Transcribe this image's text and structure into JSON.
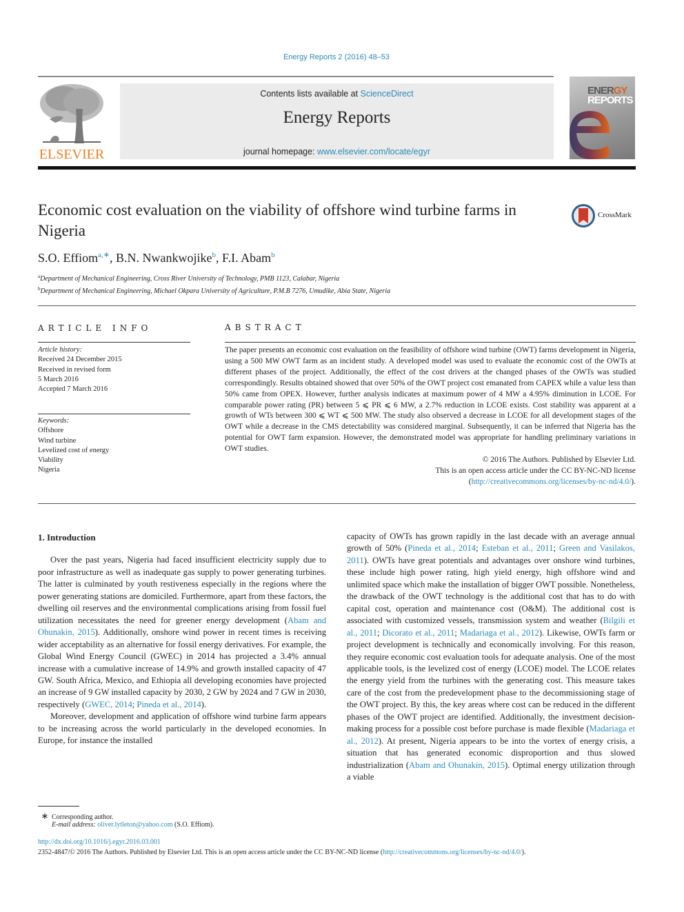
{
  "header": {
    "journal_ref": "Energy Reports 2 (2016) 48–53",
    "contents_prefix": "Contents lists available at ",
    "contents_link": "ScienceDirect",
    "journal_title": "Energy Reports",
    "homepage_prefix": "journal homepage: ",
    "homepage_link": "www.elsevier.com/locate/egyr",
    "publisher_logo_text": "ELSEVIER",
    "cover_line1_a": "ENER",
    "cover_line1_b": "GY",
    "cover_line2": "REPORTS",
    "crossmark_label": "CrossMark"
  },
  "article": {
    "title": "Economic cost evaluation on the viability of offshore wind turbine farms in Nigeria",
    "authors": [
      {
        "name": "S.O. Effiom",
        "sup": "a,∗"
      },
      {
        "name": "B.N. Nwankwojike",
        "sup": "b"
      },
      {
        "name": "F.I. Abam",
        "sup": "b"
      }
    ],
    "affiliations": [
      {
        "mark": "a",
        "text": "Department of Mechanical Engineering, Cross River University of Technology, PMB 1123, Calabar, Nigeria"
      },
      {
        "mark": "b",
        "text": "Department of Mechanical Engineering, Michael Okpara University of Agriculture, P.M.B 7276, Umudike, Abia State, Nigeria"
      }
    ]
  },
  "article_info": {
    "heading": "ARTICLE INFO",
    "history_label": "Article history:",
    "history": [
      "Received 24 December 2015",
      "Received in revised form",
      "5 March 2016",
      "Accepted 7 March 2016"
    ],
    "keywords_label": "Keywords:",
    "keywords": [
      "Offshore",
      "Wind turbine",
      "Levelized cost of energy",
      "Viability",
      "Nigeria"
    ]
  },
  "abstract": {
    "heading": "ABSTRACT",
    "text": "The paper presents an economic cost evaluation on the feasibility of offshore wind turbine (OWT) farms development in Nigeria, using a 500 MW OWT farm as an incident study. A developed model was used to evaluate the economic cost of the OWTs at different phases of the project. Additionally, the effect of the cost drivers at the changed phases of the OWTs was studied correspondingly. Results obtained showed that over 50% of the OWT project cost emanated from CAPEX while a value less than 50% came from OPEX. However, further analysis indicates at maximum power of 4 MW a 4.95% diminution in LCOE. For comparable power rating (PR) between 5 ⩽ PR ⩽ 6 MW, a 2.7% reduction in LCOE exists. Cost stability was apparent at a growth of WTs between 300 ⩽ WT ⩽ 500 MW. The study also observed a decrease in LCOE for all development stages of the OWT while a decrease in the CMS detectability was considered marginal. Subsequently, it can be inferred that Nigeria has the potential for OWT farm expansion. However, the demonstrated model was appropriate for handling preliminary variations in OWT studies.",
    "copyright": "© 2016 The Authors. Published by Elsevier Ltd.",
    "license_line": "This is an open access article under the CC BY-NC-ND license",
    "license_link": "http://creativecommons.org/licenses/by-nc-nd/4.0/"
  },
  "body": {
    "section_title": "1.  Introduction",
    "left_p1": [
      {
        "t": "Over the past years, Nigeria had faced insufficient electricity supply due to poor infrastructure as well as inadequate gas supply to power generating turbines. The latter is culminated by youth restiveness especially in the regions where the power generating stations are domiciled. Furthermore, apart from these factors, the dwelling oil reserves and the environmental complications arising from fossil fuel utilization necessitates the need for greener energy development ("
      },
      {
        "link": "Abam and Ohunakin, 2015"
      },
      {
        "t": "). Additionally, onshore wind power in recent times is receiving wider acceptability as an alternative for fossil energy derivatives. For example, the Global Wind Energy Council (GWEC) in 2014 has projected a 3.4% annual increase with a cumulative increase of 14.9% and growth installed capacity of 47 GW. South Africa, Mexico, and Ethiopia all developing economies have projected an increase of 9 GW installed capacity by 2030, 2 GW by 2024 and 7 GW in 2030, respectively ("
      },
      {
        "link": "GWEC, 2014"
      },
      {
        "t": "; "
      },
      {
        "link": "Pineda et al., 2014"
      },
      {
        "t": ")."
      }
    ],
    "left_p2": [
      {
        "t": "Moreover, development and application of offshore wind turbine farm appears to be increasing across the world particularly in the developed economies. In Europe, for instance the installed"
      }
    ],
    "right_p1": [
      {
        "t": "capacity of OWTs has grown rapidly in the last decade with an average annual growth of 50% ("
      },
      {
        "link": "Pineda et al., 2014"
      },
      {
        "t": "; "
      },
      {
        "link": "Esteban et al., 2011"
      },
      {
        "t": "; "
      },
      {
        "link": "Green and Vasilakos, 2011"
      },
      {
        "t": "). OWTs have great potentials and advantages over onshore wind turbines, these include high power rating, high yield energy, high offshore wind and unlimited space which make the installation of bigger OWT possible. Nonetheless, the drawback of the OWT technology is the additional cost that has to do with capital cost, operation and maintenance cost (O&M). The additional cost is associated with customized vessels, transmission system and weather ("
      },
      {
        "link": "Bilgili et al., 2011"
      },
      {
        "t": "; "
      },
      {
        "link": "Dicorato et al., 2011"
      },
      {
        "t": "; "
      },
      {
        "link": "Madariaga et al., 2012"
      },
      {
        "t": "). Likewise, OWTs farm or project development is technically and economically involving. For this reason, they require economic cost evaluation tools for adequate analysis. One of the most applicable tools, is the levelized cost of energy (LCOE) model. The LCOE relates the energy yield from the turbines with the generating cost. This measure takes care of the cost from the predevelopment phase to the decommissioning stage of the OWT project. By this, the key areas where cost can be reduced in the different phases of the OWT project are identified. Additionally, the investment decision-making process for a possible cost before purchase is made flexible ("
      },
      {
        "link": "Madariaga et al., 2012"
      },
      {
        "t": "). At present, Nigeria appears to be into the vortex of energy crisis, a situation that has generated economic disproportion and thus slowed industrialization ("
      },
      {
        "link": "Abam and Ohunakin, 2015"
      },
      {
        "t": "). Optimal energy utilization through a viable"
      }
    ]
  },
  "footnotes": {
    "star": "∗",
    "corresponding": "Corresponding author.",
    "email_label": "E-mail address: ",
    "email": "oliver.lytleton@yahoo.com",
    "email_suffix": " (S.O. Effiom).",
    "doi": "http://dx.doi.org/10.1016/j.egyr.2016.03.001",
    "license_prefix": "2352-4847/© 2016 The Authors. Published by Elsevier Ltd. This is an open access article under the CC BY-NC-ND license (",
    "license_link": "http://creativecommons.org/licenses/by-nc-nd/4.0/",
    "license_suffix": ")."
  },
  "colors": {
    "link": "#2a8ab8",
    "elsevier_orange": "#f07e1f",
    "masthead_bg": "#ebebeb"
  }
}
